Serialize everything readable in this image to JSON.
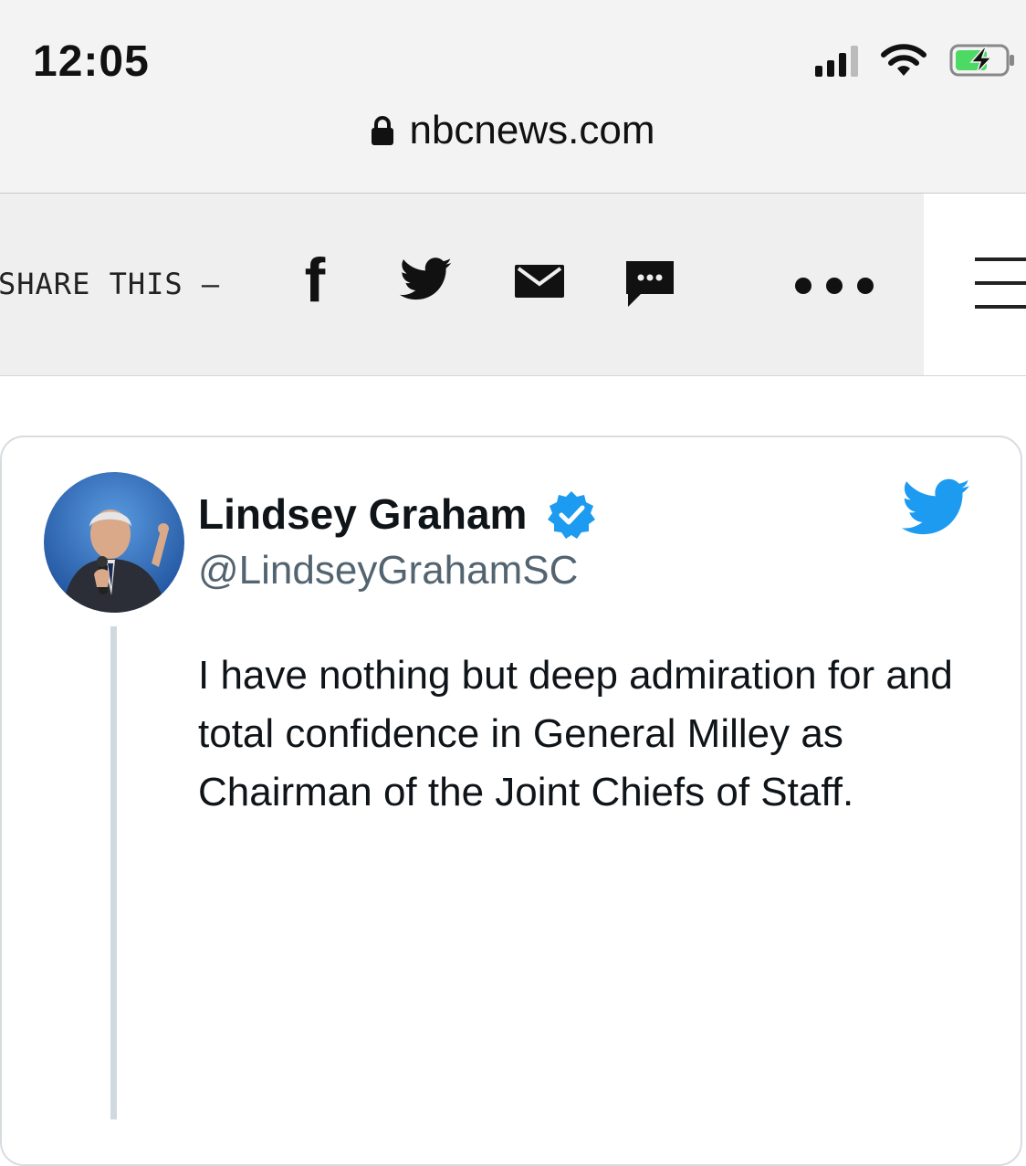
{
  "status_bar": {
    "time": "12:05",
    "icons": [
      "signal-icon",
      "wifi-icon",
      "battery-charging-icon"
    ]
  },
  "browser": {
    "url": "nbcnews.com",
    "lock_icon": "lock-icon"
  },
  "share_bar": {
    "label": "SHARE THIS —",
    "facebook_glyph": "f",
    "icons": [
      "facebook-icon",
      "twitter-icon",
      "email-icon",
      "sms-icon",
      "more-icon",
      "hamburger-icon"
    ]
  },
  "tweet": {
    "display_name": "Lindsey Graham",
    "handle": "@LindseyGrahamSC",
    "verified": true,
    "text": "I have nothing but deep admiration for and total confidence in General Milley as Chairman of the Joint Chiefs of Staff."
  },
  "colors": {
    "twitter_blue": "#1d9bf0",
    "battery_green": "#4cd964",
    "toolbar_bg": "#efefef",
    "text_primary": "#0f1419",
    "text_secondary": "#536471"
  }
}
